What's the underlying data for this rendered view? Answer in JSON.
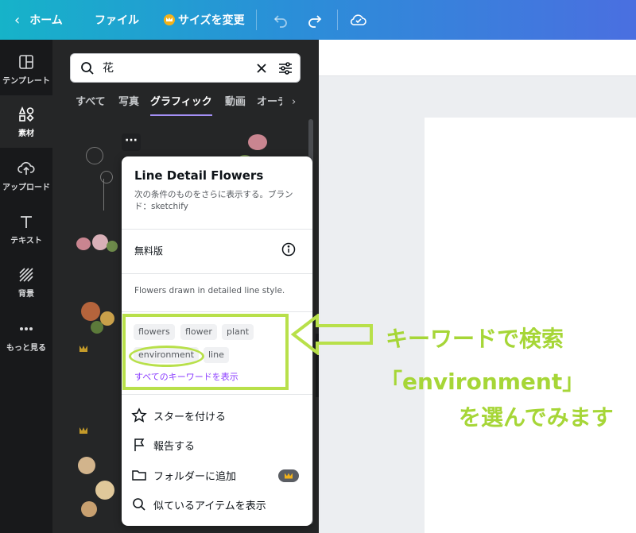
{
  "topbar": {
    "home": "ホーム",
    "file": "ファイル",
    "resize": "サイズを変更"
  },
  "rail": {
    "items": [
      {
        "label": "テンプレート"
      },
      {
        "label": "素材"
      },
      {
        "label": "アップロード"
      },
      {
        "label": "テキスト"
      },
      {
        "label": "背景"
      },
      {
        "label": "もっと見る"
      }
    ]
  },
  "search": {
    "value": "花"
  },
  "tabs": [
    "すべて",
    "写真",
    "グラフィック",
    "動画",
    "オーデ"
  ],
  "active_tab": "グラフィック",
  "popup": {
    "title": "Line Detail Flowers",
    "description": "次の条件のものをさらに表示する。ブランド：sketchify",
    "license": "無料版",
    "detail": "Flowers drawn in detailed line style.",
    "keywords": [
      "flowers",
      "flower",
      "plant",
      "environment",
      "line"
    ],
    "show_all_keywords": "すべてのキーワードを表示",
    "menu": [
      {
        "label": "スターを付ける",
        "icon": "star-icon"
      },
      {
        "label": "報告する",
        "icon": "flag-icon"
      },
      {
        "label": "フォルダーに追加",
        "icon": "folder-icon"
      },
      {
        "label": "似ているアイテムを表示",
        "icon": "search-icon"
      }
    ]
  },
  "annotation": {
    "line1": "キーワードで検索",
    "line2": "「environment」",
    "line3": "を選んでみます"
  },
  "colors": {
    "accent": "#8b3dff",
    "annotation": "#b8e04a",
    "panel": "#252627",
    "rail": "#18191b"
  }
}
